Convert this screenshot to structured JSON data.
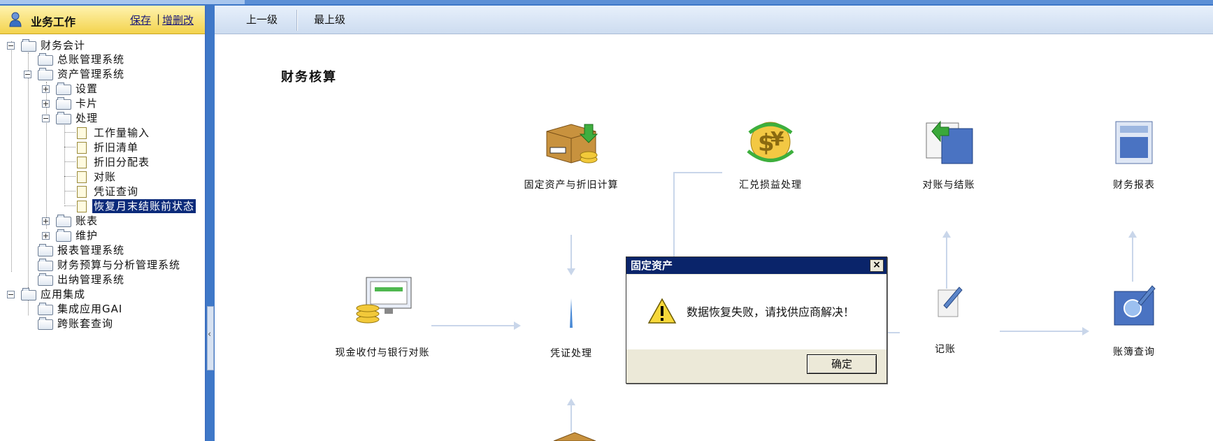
{
  "left_panel": {
    "title": "业务工作",
    "save": "保存",
    "edit": "增删改",
    "separator": "|",
    "tree": [
      {
        "label": "财务会计"
      },
      {
        "label": "总账管理系统"
      },
      {
        "label": "资产管理系统"
      },
      {
        "label": "设置"
      },
      {
        "label": "卡片"
      },
      {
        "label": "处理"
      },
      {
        "label": "工作量输入"
      },
      {
        "label": "折旧清单"
      },
      {
        "label": "折旧分配表"
      },
      {
        "label": "对账"
      },
      {
        "label": "凭证查询"
      },
      {
        "label": "恢复月末结账前状态"
      },
      {
        "label": "账表"
      },
      {
        "label": "维护"
      },
      {
        "label": "报表管理系统"
      },
      {
        "label": "财务预算与分析管理系统"
      },
      {
        "label": "出纳管理系统"
      },
      {
        "label": "应用集成"
      },
      {
        "label": "集成应用GAI"
      },
      {
        "label": "跨账套查询"
      }
    ]
  },
  "toolbar": {
    "up": "上一级",
    "top": "最上级"
  },
  "section_title": "财务核算",
  "flow": {
    "fixed_assets": "固定资产与折旧计算",
    "exchange": "汇兑损益处理",
    "reconcile": "对账与结账",
    "reports": "财务报表",
    "cash": "现金收付与银行对账",
    "voucher": "凭证处理",
    "posting": "记账",
    "ledger": "账簿查询"
  },
  "dialog": {
    "title": "固定资产",
    "message": "数据恢复失败，请找供应商解决！",
    "ok": "确定",
    "close": "×"
  },
  "splitter_glyph": "‹"
}
